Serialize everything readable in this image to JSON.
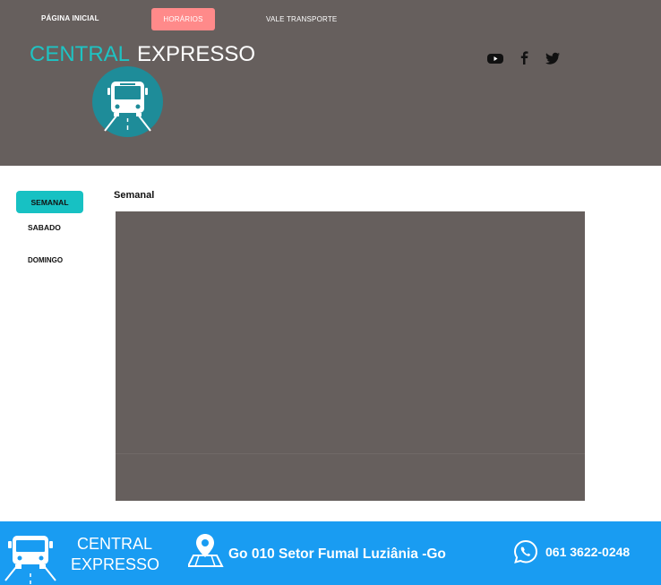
{
  "nav": {
    "home": "PÁGINA INICIAL",
    "schedules": "HORÁRIOS",
    "voucher": "VALE TRANSPORTE"
  },
  "brand": {
    "part1": "CENTRAL",
    "part2": "EXPRESSO"
  },
  "social": [
    "youtube-icon",
    "facebook-icon",
    "twitter-icon"
  ],
  "tabs": {
    "semanal": "SEMANAL",
    "sabado": "SABADO",
    "domingo": "DOMINGO"
  },
  "section_title": "Semanal",
  "footer": {
    "brand_line1": "CENTRAL",
    "brand_line2": "EXPRESSO",
    "address": "Go 010 Setor Fumal Luziânia -Go",
    "phone": "061 3622-0248"
  },
  "colors": {
    "header_bg": "#665f5d",
    "accent_teal": "#1ec3c3",
    "active_tab": "#17c1c3",
    "active_nav": "#ff8a8a",
    "footer_bg": "#199cf2"
  }
}
